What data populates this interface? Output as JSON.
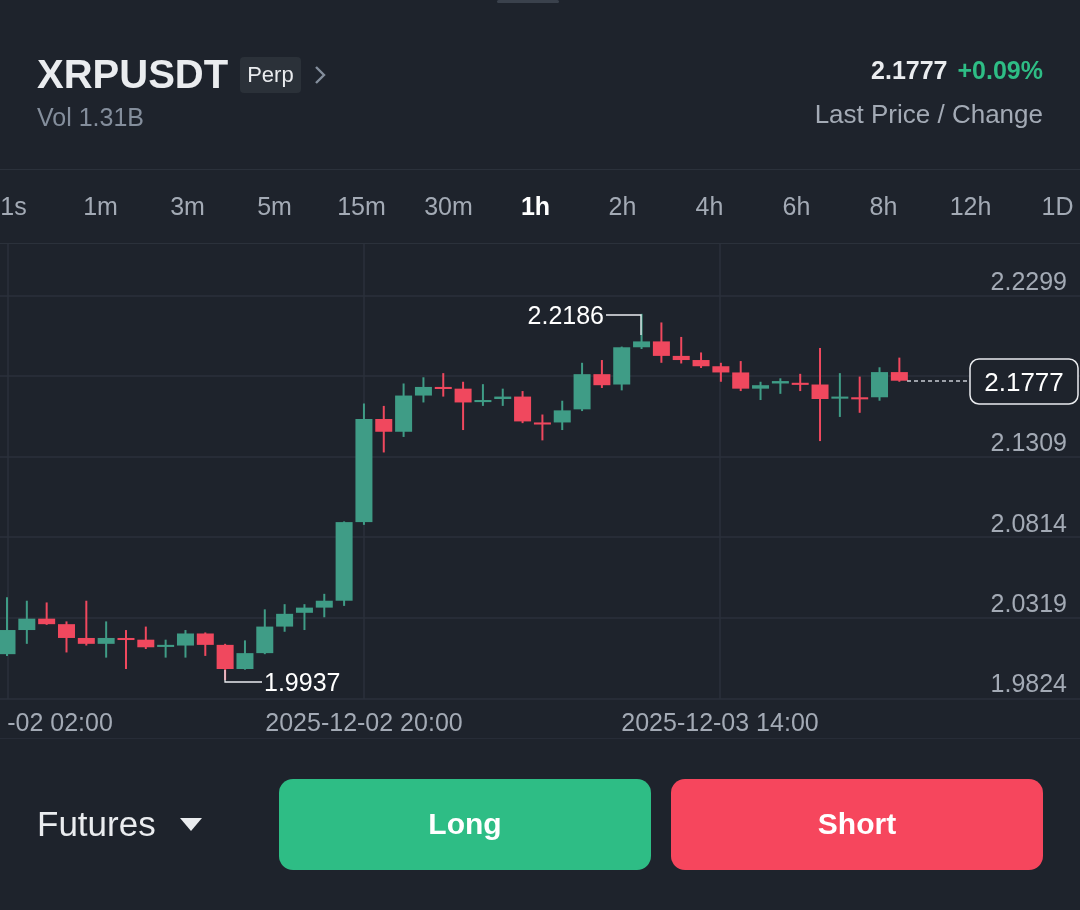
{
  "header": {
    "symbol": "XRPUSDT",
    "badge": "Perp",
    "volume": "Vol 1.31B",
    "last_price": "2.1777",
    "change": "+0.09%",
    "caption": "Last Price / Change"
  },
  "intervals": [
    {
      "label": "1s",
      "selected": false
    },
    {
      "label": "1m",
      "selected": false
    },
    {
      "label": "3m",
      "selected": false
    },
    {
      "label": "5m",
      "selected": false
    },
    {
      "label": "15m",
      "selected": false
    },
    {
      "label": "30m",
      "selected": false
    },
    {
      "label": "1h",
      "selected": true
    },
    {
      "label": "2h",
      "selected": false
    },
    {
      "label": "4h",
      "selected": false
    },
    {
      "label": "6h",
      "selected": false
    },
    {
      "label": "8h",
      "selected": false
    },
    {
      "label": "12h",
      "selected": false
    },
    {
      "label": "1D",
      "selected": false
    }
  ],
  "chart": {
    "price_labels": [
      "2.2299",
      "2.1309",
      "2.0814",
      "2.0319",
      "1.9824"
    ],
    "time_labels": [
      "-02 02:00",
      "2025-12-02 20:00",
      "2025-12-03 14:00"
    ],
    "high_marker": "2.2186",
    "low_marker": "1.9937",
    "last_price_tag": "2.1777"
  },
  "footer": {
    "market": "Futures",
    "buttons": [
      {
        "label": "Long",
        "kind": "long"
      },
      {
        "label": "Short",
        "kind": "short"
      }
    ]
  }
}
